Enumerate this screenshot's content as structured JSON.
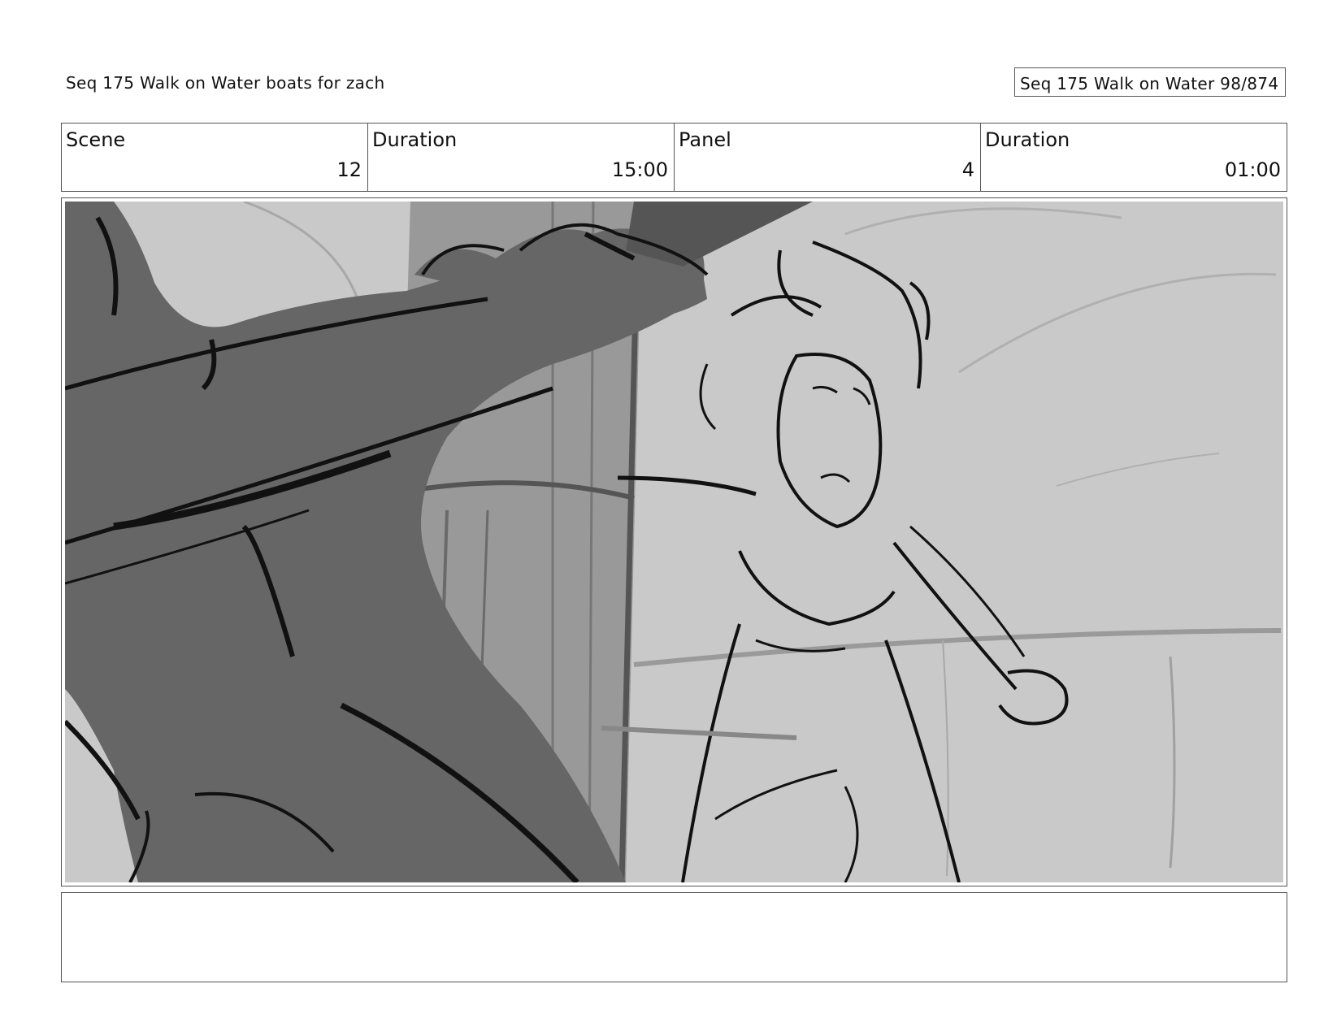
{
  "header": {
    "left_title": "Seq 175 Walk on Water  boats for zach",
    "page_label": "Seq 175 Walk on Water  98/874"
  },
  "info": [
    {
      "label": "Scene",
      "value": "12"
    },
    {
      "label": "Duration",
      "value": "15:00"
    },
    {
      "label": "Panel",
      "value": "4"
    },
    {
      "label": "Duration",
      "value": "01:00"
    }
  ],
  "panel": {
    "description": "",
    "colors": {
      "background": "#c9c9c9",
      "dark_figure": "#666666",
      "mast": "#999999",
      "lines": "#111111"
    }
  },
  "notes": ""
}
